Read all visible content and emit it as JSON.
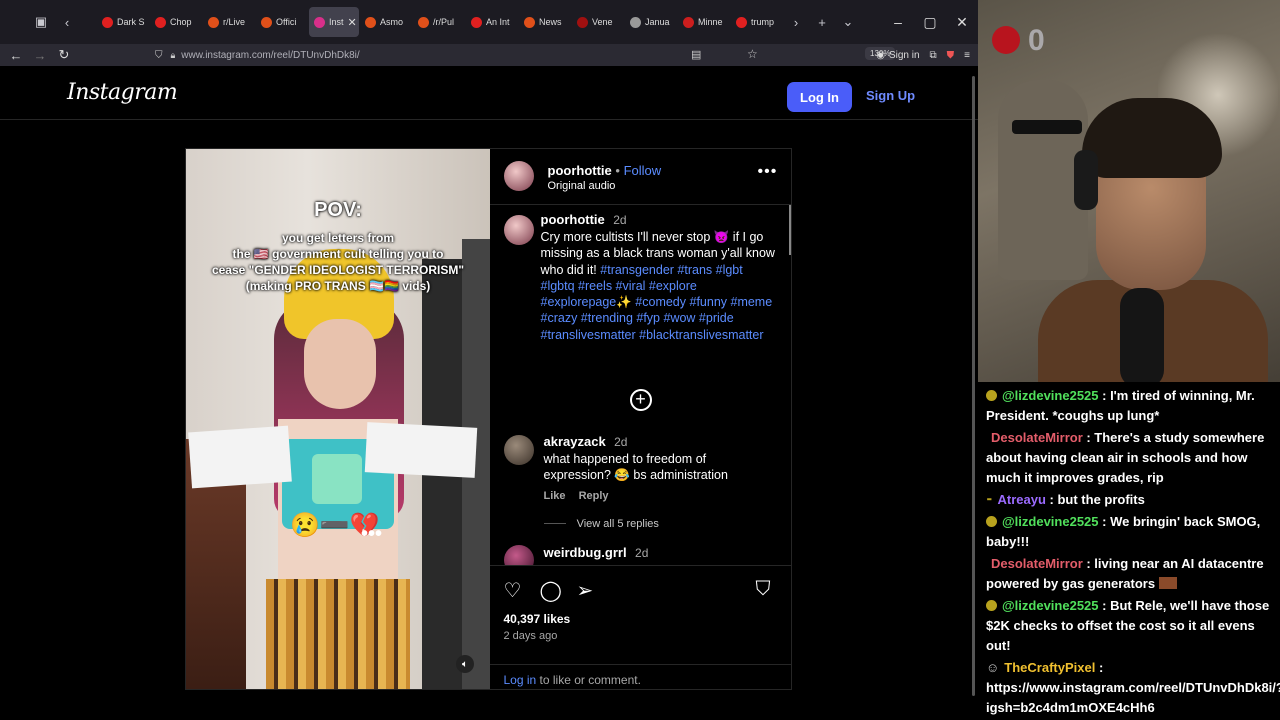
{
  "browser": {
    "tabs": [
      {
        "label": "",
        "color": "#777777"
      },
      {
        "label": "Dark S",
        "color": "#e02020"
      },
      {
        "label": "Chop",
        "color": "#e02020"
      },
      {
        "label": "r/Live",
        "color": "#e0501a"
      },
      {
        "label": "Offici",
        "color": "#e0501a"
      },
      {
        "label": "Inst",
        "color": "#d82f8a",
        "active": true
      },
      {
        "label": "Asmo",
        "color": "#e0501a"
      },
      {
        "label": "/r/Pul",
        "color": "#e0501a"
      },
      {
        "label": "An Int",
        "color": "#e02020"
      },
      {
        "label": "News",
        "color": "#e0501a"
      },
      {
        "label": "Vene",
        "color": "#a01010"
      },
      {
        "label": "Janua",
        "color": "#999999"
      },
      {
        "label": "Minne",
        "color": "#cc1e1e"
      },
      {
        "label": "trump",
        "color": "#e02020"
      }
    ],
    "url": "www.instagram.com/reel/DTUnvDhDk8i/",
    "zoom": "130%",
    "sign_in": "Sign in"
  },
  "instagram": {
    "logo": "Instagram",
    "login_button": "Log In",
    "signup_link": "Sign Up",
    "post": {
      "video_caption": {
        "title": "POV:",
        "line1": "you get letters from",
        "line2": "the 🇺🇸 government cult telling you to",
        "line3": "cease \"GENDER IDEOLOGIST TERRORISM\"",
        "line4": "(making PRO TRANS 🏳️‍⚧️🏳️‍🌈 vids)",
        "emoji": "😢➖💔"
      },
      "author": "poorhottie",
      "follow": "Follow",
      "audio": "Original audio",
      "caption": {
        "user": "poorhottie",
        "time": "2d",
        "text": "Cry more cultists I'll never stop 👿 if I go missing as a black trans woman y'all know who did it!",
        "hashtags": "#transgender #trans #lgbt #lgbtq #reels #viral #explore #explorepage✨ #comedy #funny #meme #crazy #trending #fyp #wow #pride #translivesmatter #blacktranslivesmatter"
      },
      "comments": [
        {
          "user": "akrayzack",
          "time": "2d",
          "text": "what happened to freedom of expression? 😂 bs administration",
          "like": "Like",
          "reply": "Reply",
          "view_replies": "View all 5 replies"
        },
        {
          "user": "weirdbug.grrl",
          "time": "2d"
        }
      ],
      "likes": "40,397 likes",
      "date": "2 days ago",
      "login_link": "Log in",
      "login_suffix": " to like or comment."
    }
  },
  "stream": {
    "badge_text": "0",
    "chat": [
      {
        "name": "@lizdevine2525",
        "text": " : I'm tired of winning, Mr. President. *coughs up lung*",
        "color": "green"
      },
      {
        "name": "DesolateMirror",
        "text": " : There's a study somewhere about having clean air in schools and how much it improves grades, rip",
        "color": "red"
      },
      {
        "name": "Atreayu",
        "text": " : but the profits",
        "color": "purple"
      },
      {
        "name": "@lizdevine2525",
        "text": " : We bringin' back SMOG, baby!!!",
        "color": "green"
      },
      {
        "name": "DesolateMirror",
        "text": " : living near an AI datacentre powered by gas generators",
        "color": "red"
      },
      {
        "name": "@lizdevine2525",
        "text": " : But Rele, we'll have those $2K checks to offset the cost so it all evens out!",
        "color": "green"
      },
      {
        "name": "TheCraftyPixel",
        "text": " : https://www.instagram.com/reel/DTUnvDhDk8i/?igsh=b2c4dm1mOXE4cHh6",
        "color": "yellow"
      }
    ]
  }
}
